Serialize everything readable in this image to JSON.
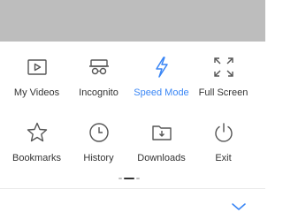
{
  "menu": {
    "items": [
      {
        "label": "My Videos",
        "icon": "video-icon"
      },
      {
        "label": "Incognito",
        "icon": "incognito-icon"
      },
      {
        "label": "Speed Mode",
        "icon": "lightning-icon"
      },
      {
        "label": "Full Screen",
        "icon": "fullscreen-icon"
      },
      {
        "label": "Bookmarks",
        "icon": "star-icon"
      },
      {
        "label": "History",
        "icon": "clock-icon"
      },
      {
        "label": "Downloads",
        "icon": "download-folder-icon"
      },
      {
        "label": "Exit",
        "icon": "power-icon"
      }
    ],
    "active_index": 2,
    "page_indicator": {
      "pages": 3,
      "current": 2
    }
  },
  "colors": {
    "accent": "#3a86f5",
    "text": "#333333",
    "icon": "#555555",
    "backdrop": "#bdbdbd"
  }
}
